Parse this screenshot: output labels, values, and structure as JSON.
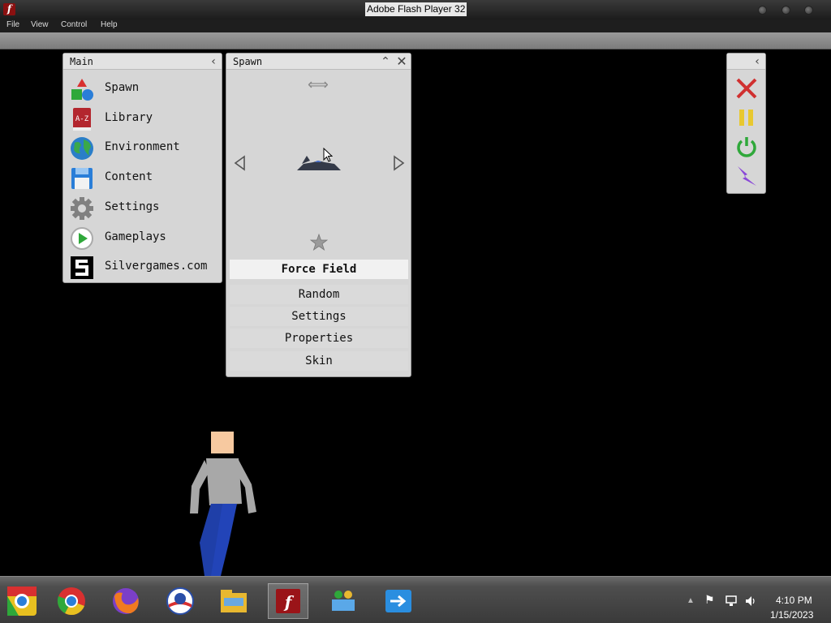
{
  "window": {
    "title": "Adobe Flash Player 32",
    "app_icon": "flash-icon"
  },
  "menubar": {
    "items": [
      "File",
      "View",
      "Control",
      "Help"
    ]
  },
  "main_panel": {
    "title": "Main",
    "items": [
      {
        "label": "Spawn",
        "icon": "shapes-icon"
      },
      {
        "label": "Library",
        "icon": "book-icon"
      },
      {
        "label": "Environment",
        "icon": "globe-icon"
      },
      {
        "label": "Content",
        "icon": "floppy-disk-icon"
      },
      {
        "label": "Settings",
        "icon": "gear-icon"
      },
      {
        "label": "Gameplays",
        "icon": "play-icon"
      },
      {
        "label": "Silvergames.com",
        "icon": "silvergames-logo-icon"
      }
    ]
  },
  "spawn_panel": {
    "title": "Spawn",
    "selected": "Force Field",
    "options": [
      "Random",
      "Settings",
      "Properties",
      "Skin"
    ]
  },
  "tools_panel": {
    "buttons": [
      "close-icon",
      "pause-icon",
      "power-icon",
      "lightning-icon"
    ]
  },
  "taskbar": {
    "apps": [
      "chrome-old-icon",
      "chrome-icon",
      "firefox-icon",
      "obama-logo-icon",
      "file-explorer-icon",
      "flash-icon",
      "network-people-icon",
      "remote-app-icon"
    ],
    "clock": {
      "time": "4:10 PM",
      "date": "1/15/2023"
    }
  },
  "colors": {
    "background": "#000000",
    "panel": "#d6d6d6",
    "selected": "#f1f1f1"
  }
}
